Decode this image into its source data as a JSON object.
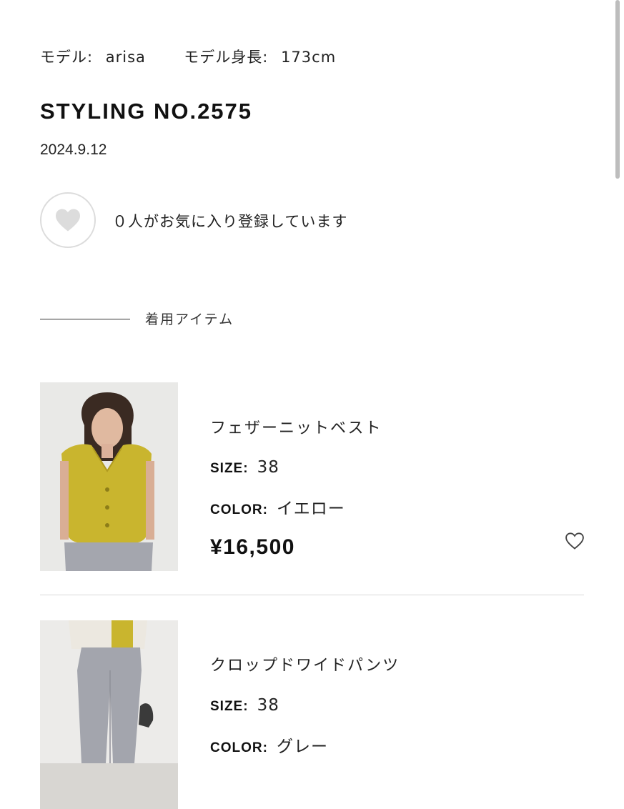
{
  "model": {
    "name_label": "モデル:",
    "name": "arisa",
    "height_label": "モデル身長:",
    "height": "173cm"
  },
  "styling": {
    "title": "STYLING NO.2575",
    "date": "2024.9.12"
  },
  "favorite": {
    "text": "０人がお気に入り登録しています",
    "icon": "heart-icon"
  },
  "section": {
    "label": "着用アイテム"
  },
  "labels": {
    "size": "SIZE:",
    "color": "COLOR:"
  },
  "products": [
    {
      "name": "フェザーニットベスト",
      "size": "38",
      "color": "イエロー",
      "price": "¥16,500"
    },
    {
      "name": "クロップドワイドパンツ",
      "size": "38",
      "color": "グレー",
      "price": ""
    }
  ],
  "colors": {
    "text": "#1a1a1a",
    "divider": "#d8d8d8",
    "heart_fill": "#dcdcdc",
    "vest_yellow": "#c9b52e",
    "pants_grey": "#a3a5ad"
  }
}
